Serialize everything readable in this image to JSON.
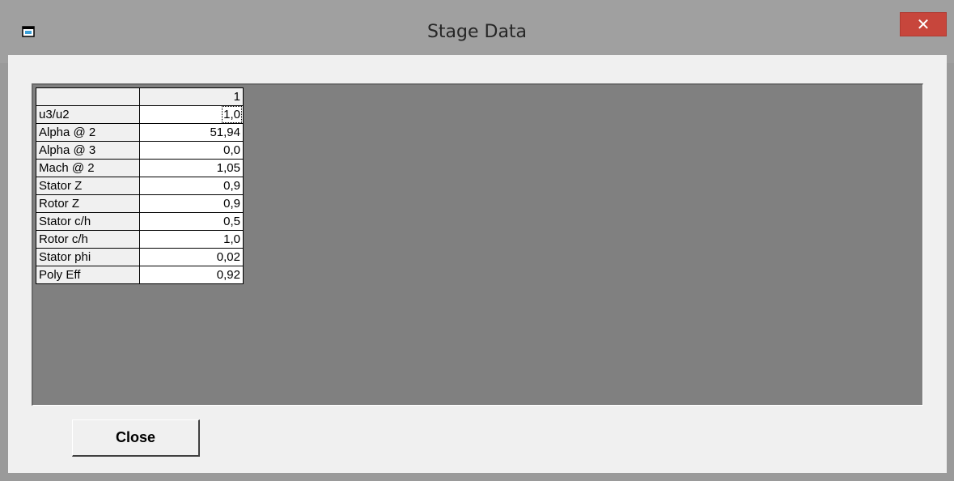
{
  "window": {
    "title": "Stage Data",
    "close_glyph": "✕",
    "icon": "app-window-icon"
  },
  "grid": {
    "column_headers": [
      "1"
    ],
    "rows": [
      {
        "label": "u3/u2",
        "value": "1,0"
      },
      {
        "label": "Alpha @ 2",
        "value": "51,94"
      },
      {
        "label": "Alpha @ 3",
        "value": "0,0"
      },
      {
        "label": "Mach @ 2",
        "value": "1,05"
      },
      {
        "label": "Stator Z",
        "value": "0,9"
      },
      {
        "label": "Rotor  Z",
        "value": "0,9"
      },
      {
        "label": "Stator c/h",
        "value": "0,5"
      },
      {
        "label": "Rotor  c/h",
        "value": "1,0"
      },
      {
        "label": "Stator phi",
        "value": "0,02"
      },
      {
        "label": "Poly Eff",
        "value": "0,92"
      }
    ]
  },
  "buttons": {
    "close_label": "Close"
  },
  "colors": {
    "titlebar": "#a0a0a0",
    "close_button": "#c7463c",
    "grid_background": "#808080",
    "dialog_background": "#f0f0f0"
  }
}
